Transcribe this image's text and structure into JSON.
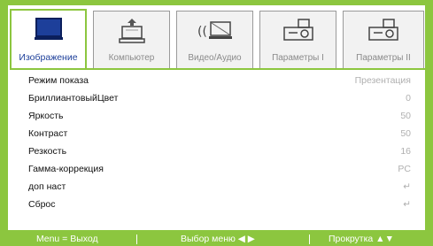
{
  "tabs": [
    {
      "label": "Изображение",
      "icon": "monitor-icon",
      "active": true
    },
    {
      "label": "Компьютер",
      "icon": "computer-icon",
      "active": false
    },
    {
      "label": "Видео/Аудио",
      "icon": "video-audio-icon",
      "active": false
    },
    {
      "label": "Параметры I",
      "icon": "projector-icon",
      "active": false
    },
    {
      "label": "Параметры II",
      "icon": "projector-icon",
      "active": false
    }
  ],
  "menu": {
    "items": [
      {
        "label": "Режим показа",
        "value": "Презентация"
      },
      {
        "label": "БриллиантовыйЦвет",
        "value": "0"
      },
      {
        "label": "Яркость",
        "value": "50"
      },
      {
        "label": "Контраст",
        "value": "50"
      },
      {
        "label": "Резкость",
        "value": "16"
      },
      {
        "label": "Гамма-коррекция",
        "value": "PC"
      },
      {
        "label": "доп наст",
        "value": "↵"
      },
      {
        "label": "Сброс",
        "value": "↵"
      }
    ]
  },
  "footer": {
    "exit": "Menu = Выход",
    "select": "Выбор меню ◀ ▶",
    "scroll": "Прокрутка ▲▼"
  },
  "colors": {
    "accent": "#8cc63f",
    "active_tab_text": "#1d3f9a",
    "value_text": "#b0b0b0"
  }
}
